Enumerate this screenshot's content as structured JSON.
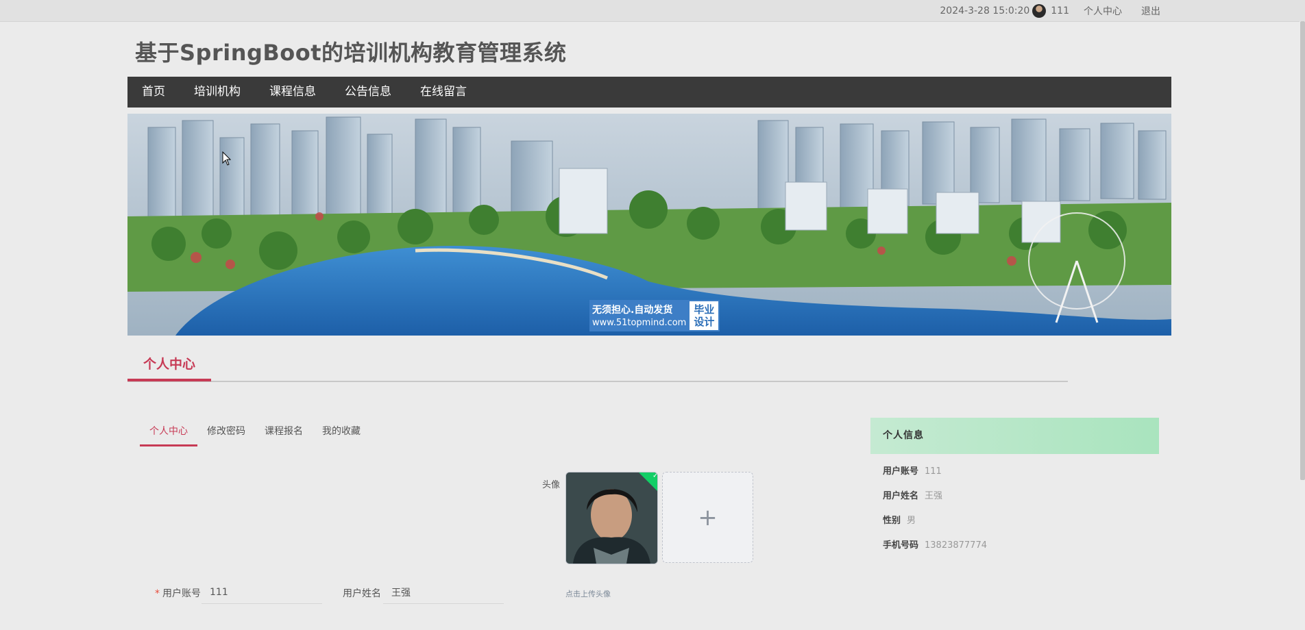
{
  "topbar": {
    "datetime": "2024-3-28 15:0:20",
    "username": "111",
    "personal_center": "个人中心",
    "logout": "退出"
  },
  "site_title": "基于SpringBoot的培训机构教育管理系统",
  "nav": {
    "items": [
      {
        "label": "首页"
      },
      {
        "label": "培训机构"
      },
      {
        "label": "课程信息"
      },
      {
        "label": "公告信息"
      },
      {
        "label": "在线留言"
      }
    ]
  },
  "banner": {
    "badge_line1": "无须担心.自动发货",
    "badge_line2": "www.51topmind.com",
    "badge_right_line1": "毕业",
    "badge_right_line2": "设计"
  },
  "section": {
    "title": "个人中心"
  },
  "tabs": [
    {
      "label": "个人中心",
      "active": true
    },
    {
      "label": "修改密码",
      "active": false
    },
    {
      "label": "课程报名",
      "active": false
    },
    {
      "label": "我的收藏",
      "active": false
    }
  ],
  "form": {
    "avatar_label": "头像",
    "upload_hint": "点击上传头像",
    "upload_plus": "+",
    "account_label": "用户账号",
    "account_value": "111",
    "name_label": "用户姓名",
    "name_value": "王强"
  },
  "info_panel": {
    "title": "个人信息",
    "rows": [
      {
        "key": "用户账号",
        "value": "111"
      },
      {
        "key": "用户姓名",
        "value": "王强"
      },
      {
        "key": "性别",
        "value": "男"
      },
      {
        "key": "手机号码",
        "value": "13823877774"
      }
    ]
  },
  "colors": {
    "accent": "#c73a55",
    "nav_bg": "#3a3a3a",
    "info_head": "#b5e6c6",
    "upload_success": "#13ce66"
  }
}
